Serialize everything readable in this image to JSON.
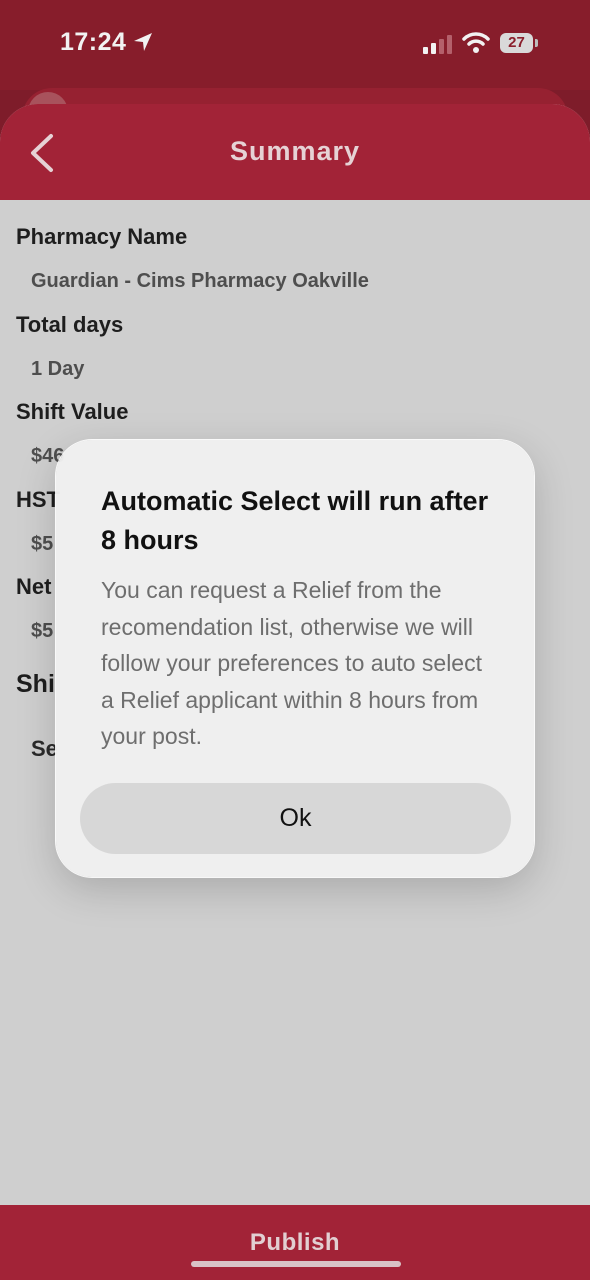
{
  "status_bar": {
    "time": "17:24",
    "battery": "27",
    "icons": [
      "location-arrow-icon",
      "cellular-signal-icon",
      "wifi-icon",
      "battery-icon"
    ]
  },
  "header": {
    "title": "Summary",
    "back_icon": "chevron-left-icon"
  },
  "summary": {
    "pharmacy_name_label": "Pharmacy Name",
    "pharmacy_name_value": "Guardian - Cims Pharmacy Oakville",
    "total_days_label": "Total days",
    "total_days_value": "1 Day",
    "shift_value_label": "Shift Value",
    "shift_value_value": "$46",
    "hst_label": "HST",
    "hst_value": "$5",
    "net_label": "Net",
    "net_value": "$5",
    "shift_section_title": "Shi",
    "shift_row_label": "Se"
  },
  "dialog": {
    "title": "Automatic Select will run after 8 hours",
    "message": "You can request a Relief from the recomendation list, otherwise we will follow your preferences to auto select a Relief applicant within 8 hours from your post.",
    "ok_label": "Ok"
  },
  "footer": {
    "publish_label": "Publish"
  },
  "colors": {
    "brand_red": "#a22337",
    "status_bar": "#871d2b",
    "overlay_gray": "#cfcfcf"
  }
}
